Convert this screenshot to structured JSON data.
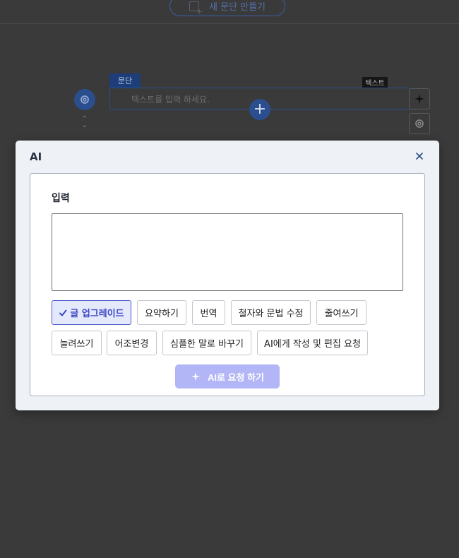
{
  "background": {
    "new_paragraph_button": "새 문단 만들기",
    "paragraph_tag": "문단",
    "text_tag": "텍스트",
    "text_placeholder": "텍스트를 입력 하세요."
  },
  "modal": {
    "title": "AI",
    "input_label": "입력",
    "input_value": "",
    "options": [
      {
        "label": "글 업그레이드",
        "selected": true
      },
      {
        "label": "요약하기",
        "selected": false
      },
      {
        "label": "번역",
        "selected": false
      },
      {
        "label": "철자와 문법 수정",
        "selected": false
      },
      {
        "label": "줄여쓰기",
        "selected": false
      },
      {
        "label": "늘려쓰기",
        "selected": false
      },
      {
        "label": "어조변경",
        "selected": false
      },
      {
        "label": "심플한 말로 바꾸기",
        "selected": false
      },
      {
        "label": "AI에게 작성 및 편집 요청",
        "selected": false
      }
    ],
    "submit_label": "AI로 요청 하기"
  },
  "icons": {
    "close": "close-icon",
    "check": "check-icon",
    "sparkle": "sparkle-icon",
    "gear": "gear-icon",
    "plus": "plus-icon"
  },
  "colors": {
    "accent": "#4c57cf",
    "selected_bg": "#e5e9fc",
    "submit_bg": "#b3b6f6",
    "editor_blue": "#2a4e8e"
  }
}
